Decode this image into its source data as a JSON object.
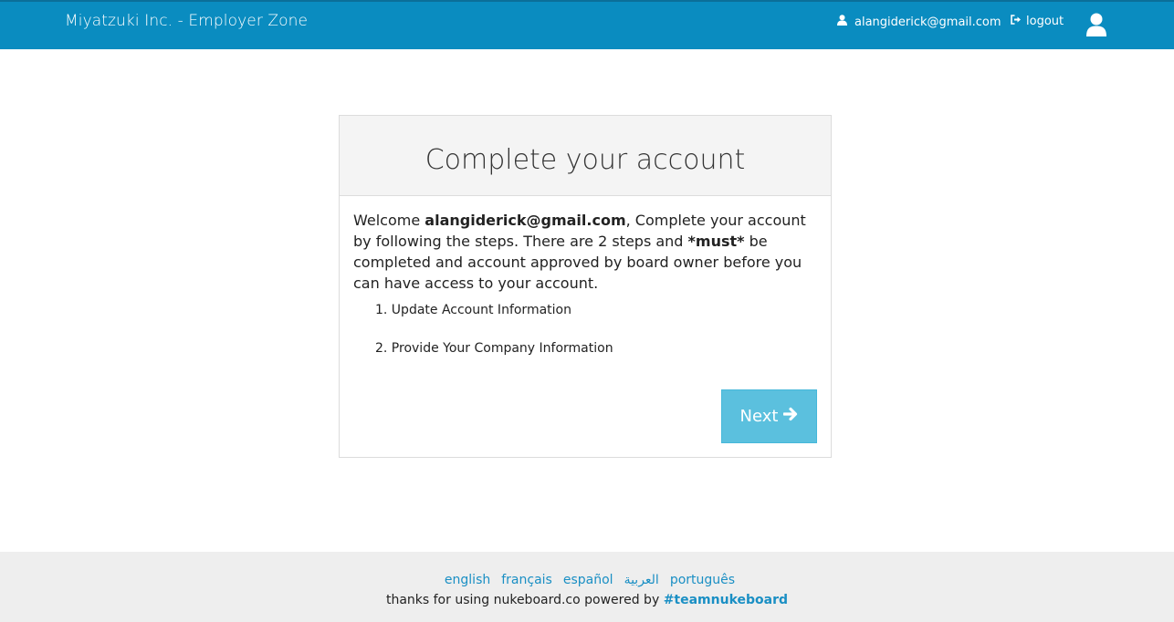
{
  "header": {
    "brand": "Miyatzuki Inc. - Employer Zone",
    "user_email": "alangiderick@gmail.com",
    "logout_label": "logout",
    "icons": {
      "user": "user-icon",
      "logout": "sign-out-icon",
      "avatar": "avatar-icon"
    }
  },
  "card": {
    "title": "Complete your account",
    "intro": {
      "p1": "Welcome ",
      "email": "alangiderick@gmail.com",
      "p2": ", Complete your account by following the steps. There are 2 steps and ",
      "must": "*must*",
      "p3": " be completed and account approved by board owner before you can have access to your account."
    },
    "steps": [
      "1. Update Account Information",
      "2. Provide Your Company Information"
    ],
    "next_label": "Next"
  },
  "footer": {
    "languages": [
      "english",
      "français",
      "español",
      "العربية",
      "português"
    ],
    "thanks_text": "thanks for using nukeboard.co powered by ",
    "hashtag": "#teamnukeboard"
  },
  "colors": {
    "header_bg": "#0a8cc0",
    "button_bg": "#5bc0de",
    "link": "#1a8fc4",
    "footer_bg": "#eeeeee"
  }
}
